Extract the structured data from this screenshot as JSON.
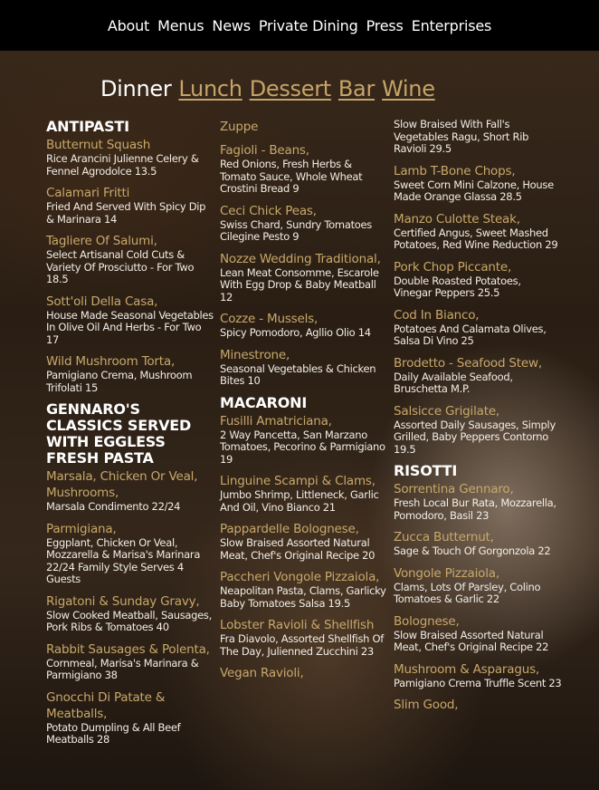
{
  "nav": [
    "About",
    "Menus",
    "News",
    "Private Dining",
    "Press",
    "Enterprises"
  ],
  "tabs": {
    "current": "Dinner",
    "links": [
      "Lunch",
      "Dessert",
      "Bar",
      "Wine"
    ]
  },
  "columns": [
    [
      {
        "section": "ANTIPASTI"
      },
      {
        "name": "Butternut Squash",
        "desc": "Rice Arancini Julienne Celery & Fennel Agrodolce 13.5"
      },
      {
        "name": "Calamari Fritti",
        "desc": "Fried And Served With Spicy Dip & Marinara 14"
      },
      {
        "name": "Tagliere Of Salumi,",
        "desc": "Select Artisanal Cold Cuts & Variety Of Prosciutto - For Two 18.5"
      },
      {
        "name": "Sott'oli Della Casa,",
        "desc": "House Made Seasonal Vegetables In Olive Oil And Herbs - For Two 17"
      },
      {
        "name": "Wild Mushroom Torta,",
        "desc": "Pamigiano Crema, Mushroom Trifolati 15"
      },
      {
        "section": "GENNARO'S CLASSICS SERVED WITH EGGLESS FRESH PASTA"
      },
      {
        "name": "Marsala, Chicken Or Veal, Mushrooms,",
        "desc": "Marsala Condimento 22/24"
      },
      {
        "name": "Parmigiana,",
        "desc": "Eggplant, Chicken Or Veal, Mozzarella & Marisa's Marinara 22/24 Family Style Serves 4 Guests"
      },
      {
        "name": "Rigatoni & Sunday Gravy,",
        "desc": "Slow Cooked Meatball, Sausages, Pork Ribs & Tomatoes 40"
      },
      {
        "name": "Rabbit Sausages & Polenta,",
        "desc": "Cornmeal, Marisa's Marinara & Parmigiano 38"
      },
      {
        "name": "Gnocchi Di Patate & Meatballs,",
        "desc": "Potato Dumpling & All Beef Meatballs 28"
      }
    ],
    [
      {
        "name": "Zuppe"
      },
      {
        "name": "Fagioli - Beans,",
        "desc": "Red Onions, Fresh Herbs & Tomato Sauce, Whole Wheat Crostini Bread 9"
      },
      {
        "name": "Ceci Chick Peas,",
        "desc": "Swiss Chard, Sundry Tomatoes Cilegine Pesto 9"
      },
      {
        "name": "Nozze Wedding Traditional,",
        "desc": "Lean Meat Consomme, Escarole With Egg Drop & Baby Meatball 12"
      },
      {
        "name": "Cozze - Mussels,",
        "desc": "Spicy Pomodoro, Agllio Olio 14"
      },
      {
        "name": "Minestrone,",
        "desc": "Seasonal Vegetables & Chicken Bites 10"
      },
      {
        "section": "MACARONI"
      },
      {
        "name": "Fusilli Amatriciana,",
        "desc": "2 Way Pancetta, San Marzano Tomatoes, Pecorino & Parmigiano 19"
      },
      {
        "name": "Linguine Scampi & Clams,",
        "desc": "Jumbo Shrimp, Littleneck, Garlic And Oil, Vino Bianco 21"
      },
      {
        "name": "Pappardelle Bolognese,",
        "desc": "Slow Braised Assorted Natural Meat, Chef's Original Recipe 20"
      },
      {
        "name": "Paccheri Vongole Pizzaiola,",
        "desc": "Neapolitan Pasta, Clams, Garlicky Baby Tomatoes Salsa 19.5"
      },
      {
        "name": "Lobster Ravioli & Shellfish",
        "desc": "Fra Diavolo, Assorted Shellfish Of The Day, Julienned Zucchini 23"
      },
      {
        "name": "Vegan Ravioli,",
        "desc": ""
      }
    ],
    [
      {
        "name": "",
        "desc": "Slow Braised With Fall's Vegetables Ragu, Short Rib Ravioli 29.5"
      },
      {
        "name": "Lamb T-Bone Chops,",
        "desc": "Sweet Corn Mini Calzone, House Made Orange Glassa 28.5"
      },
      {
        "name": "Manzo Culotte Steak,",
        "desc": "Certified Angus, Sweet Mashed Potatoes, Red Wine Reduction 29"
      },
      {
        "name": "Pork Chop Piccante,",
        "desc": "Double Roasted Potatoes, Vinegar Peppers 25.5"
      },
      {
        "name": "Cod In Bianco,",
        "desc": "Potatoes And Calamata Olives, Salsa Di Vino 25"
      },
      {
        "name": "Brodetto - Seafood Stew,",
        "desc": "Daily Available Seafood, Bruschetta M.P."
      },
      {
        "name": "Salsicce Grigilate,",
        "desc": "Assorted Daily Sausages, Simply Grilled, Baby Peppers Contorno 19.5"
      },
      {
        "section": "RISOTTI"
      },
      {
        "name": "Sorrentina Gennaro,",
        "desc": "Fresh Local Bur Rata, Mozzarella, Pomodoro, Basil 23"
      },
      {
        "name": "Zucca Butternut,",
        "desc": "Sage & Touch Of Gorgonzola 22"
      },
      {
        "name": "Vongole Pizzaiola,",
        "desc": "Clams, Lots Of Parsley, Colino Tomatoes & Garlic 22"
      },
      {
        "name": "Bolognese,",
        "desc": "Slow Braised Assorted Natural Meat, Chef's Original Recipe 22"
      },
      {
        "name": "Mushroom & Asparagus,",
        "desc": "Pamigiano Crema Truffle Scent 23"
      },
      {
        "name": "Slim Good,",
        "desc": ""
      }
    ]
  ]
}
